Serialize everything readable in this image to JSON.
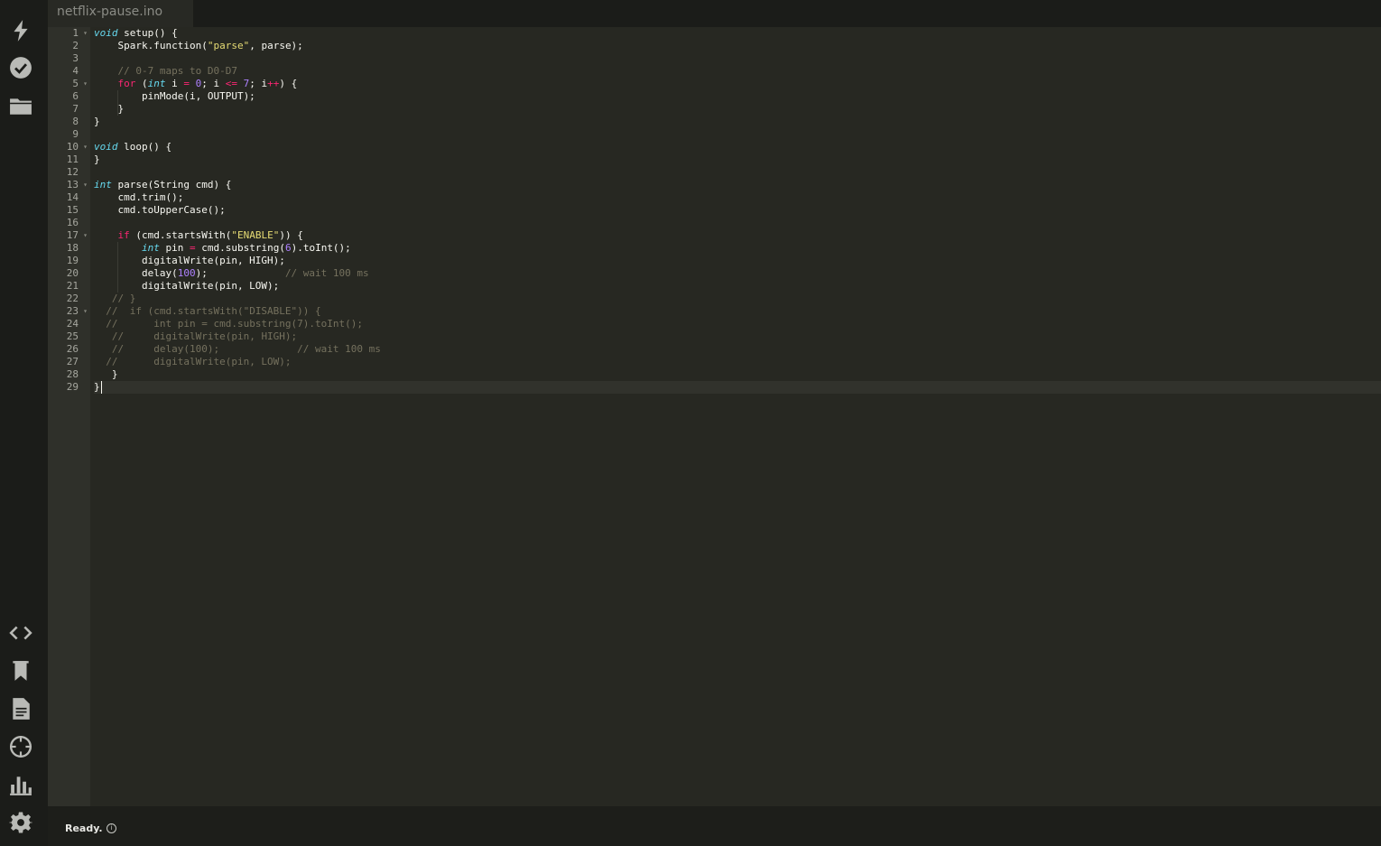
{
  "tab": {
    "filename": "netflix-pause.ino"
  },
  "sidebar": {
    "top_icons": [
      "flash-icon",
      "verify-icon",
      "files-icon"
    ],
    "bottom_icons": [
      "code-icon",
      "libraries-icon",
      "docs-icon",
      "devices-icon",
      "console-icon",
      "settings-icon"
    ]
  },
  "editor": {
    "line_numbers": [
      "1",
      "2",
      "3",
      "4",
      "5",
      "6",
      "7",
      "8",
      "9",
      "10",
      "11",
      "12",
      "13",
      "14",
      "15",
      "16",
      "17",
      "18",
      "19",
      "20",
      "21",
      "22",
      "23",
      "24",
      "25",
      "26",
      "27",
      "28",
      "29"
    ],
    "fold_marks": [
      "▾",
      "",
      "",
      "",
      "▾",
      "",
      "",
      "",
      "",
      "▾",
      "",
      "",
      "▾",
      "",
      "",
      "",
      "▾",
      "",
      "",
      "",
      "",
      "",
      "▾",
      "",
      "",
      "",
      "",
      "",
      ""
    ],
    "lines": [
      [
        [
          "t",
          "void"
        ],
        [
          "p",
          " setup() {"
        ]
      ],
      [
        [
          "p",
          "    Spark.function("
        ],
        [
          "s",
          "\"parse\""
        ],
        [
          "p",
          ", parse);"
        ]
      ],
      [],
      [
        [
          "p",
          "    "
        ],
        [
          "c",
          "// 0-7 maps to D0-D7"
        ]
      ],
      [
        [
          "p",
          "    "
        ],
        [
          "k",
          "for"
        ],
        [
          "p",
          " ("
        ],
        [
          "t",
          "int"
        ],
        [
          "p",
          " i "
        ],
        [
          "k",
          "="
        ],
        [
          "p",
          " "
        ],
        [
          "n",
          "0"
        ],
        [
          "p",
          "; i "
        ],
        [
          "k",
          "<="
        ],
        [
          "p",
          " "
        ],
        [
          "n",
          "7"
        ],
        [
          "p",
          "; i"
        ],
        [
          "k",
          "++"
        ],
        [
          "p",
          ") {"
        ]
      ],
      [
        [
          "p",
          "        pinMode(i, OUTPUT);"
        ]
      ],
      [
        [
          "p",
          "    }"
        ]
      ],
      [
        [
          "p",
          "}"
        ]
      ],
      [],
      [
        [
          "t",
          "void"
        ],
        [
          "p",
          " loop() {"
        ]
      ],
      [
        [
          "p",
          "}"
        ]
      ],
      [],
      [
        [
          "t",
          "int"
        ],
        [
          "p",
          " parse(String cmd) {"
        ]
      ],
      [
        [
          "p",
          "    cmd.trim();"
        ]
      ],
      [
        [
          "p",
          "    cmd.toUpperCase();"
        ]
      ],
      [],
      [
        [
          "p",
          "    "
        ],
        [
          "k",
          "if"
        ],
        [
          "p",
          " (cmd.startsWith("
        ],
        [
          "s",
          "\"ENABLE\""
        ],
        [
          "p",
          ")) {"
        ]
      ],
      [
        [
          "p",
          "        "
        ],
        [
          "t",
          "int"
        ],
        [
          "p",
          " pin "
        ],
        [
          "k",
          "="
        ],
        [
          "p",
          " cmd.substring("
        ],
        [
          "n",
          "6"
        ],
        [
          "p",
          ").toInt();"
        ]
      ],
      [
        [
          "p",
          "        digitalWrite(pin, HIGH);"
        ]
      ],
      [
        [
          "p",
          "        delay("
        ],
        [
          "n",
          "100"
        ],
        [
          "p",
          ");             "
        ],
        [
          "c",
          "// wait 100 ms"
        ]
      ],
      [
        [
          "p",
          "        digitalWrite(pin, LOW);"
        ]
      ],
      [
        [
          "p",
          "   "
        ],
        [
          "c",
          "// }"
        ]
      ],
      [
        [
          "p",
          "  "
        ],
        [
          "c",
          "//  if (cmd.startsWith(\"DISABLE\")) {"
        ]
      ],
      [
        [
          "p",
          "  "
        ],
        [
          "c",
          "//      int pin = cmd.substring(7).toInt();"
        ]
      ],
      [
        [
          "p",
          "   "
        ],
        [
          "c",
          "//     digitalWrite(pin, HIGH);"
        ]
      ],
      [
        [
          "p",
          "   "
        ],
        [
          "c",
          "//     delay(100);             // wait 100 ms"
        ]
      ],
      [
        [
          "p",
          "  "
        ],
        [
          "c",
          "//      digitalWrite(pin, LOW);"
        ]
      ],
      [
        [
          "p",
          "   }"
        ]
      ],
      [
        [
          "p",
          "}"
        ]
      ]
    ]
  },
  "status": {
    "text": "Ready.",
    "info_icon": "i"
  }
}
